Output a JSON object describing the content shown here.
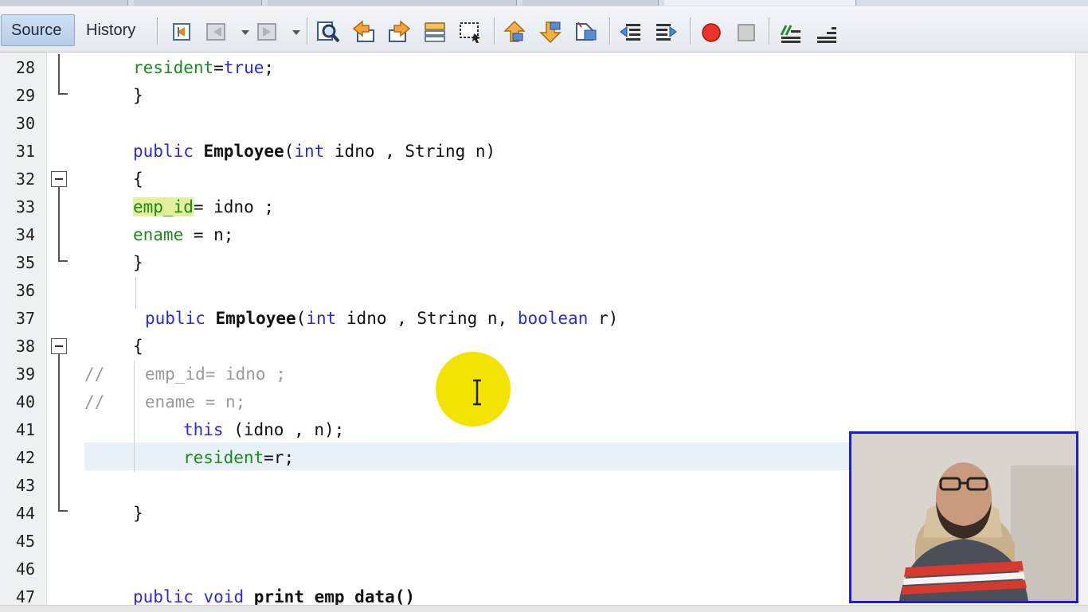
{
  "toolbar": {
    "source_label": "Source",
    "history_label": "History",
    "icons": [
      "last-edit-icon",
      "back-icon",
      "forward-icon",
      "find-icon",
      "find-previous-icon",
      "find-next-icon",
      "toggle-highlight-icon",
      "rectangle-selection-icon",
      "previous-bookmark-icon",
      "next-bookmark-icon",
      "toggle-bookmark-icon",
      "shift-left-icon",
      "shift-right-icon",
      "record-macro-icon",
      "stop-macro-icon",
      "comment-icon",
      "uncomment-icon"
    ]
  },
  "lines": [
    {
      "num": "28"
    },
    {
      "num": "29"
    },
    {
      "num": "30"
    },
    {
      "num": "31"
    },
    {
      "num": "32"
    },
    {
      "num": "33"
    },
    {
      "num": "34"
    },
    {
      "num": "35"
    },
    {
      "num": "36"
    },
    {
      "num": "37"
    },
    {
      "num": "38"
    },
    {
      "num": "39"
    },
    {
      "num": "40"
    },
    {
      "num": "41"
    },
    {
      "num": "42"
    },
    {
      "num": "43"
    },
    {
      "num": "44"
    },
    {
      "num": "45"
    },
    {
      "num": "46"
    },
    {
      "num": "47"
    }
  ],
  "code": {
    "l28_field": "resident",
    "l28_rest": "=",
    "l28_kw": "true",
    "l28_end": ";",
    "l29": "}",
    "l31_kw1": "public",
    "l31_name": "Employee",
    "l31_p1": "(",
    "l31_kw2": "int",
    "l31_p2": " idno , String n)",
    "l32": "{",
    "l33_field": "emp_id",
    "l33_rest": "= idno ;",
    "l34_field": "ename",
    "l34_rest": " = n;",
    "l35": "}",
    "l37_kw1": "public",
    "l37_name": "Employee",
    "l37_p1": "(",
    "l37_kw2": "int",
    "l37_p2": " idno , String n, ",
    "l37_kw3": "boolean",
    "l37_p3": " r)",
    "l38": "{",
    "l39_comment": "//    emp_id= idno ;",
    "l40_comment": "//    ename = n;",
    "l41_kw": "this",
    "l41_rest": " (idno , n);",
    "l42_field": "resident",
    "l42_rest": "=r;",
    "l44": "}",
    "l47_kw1": "public",
    "l47_kw2": "void",
    "l47_rest": "print emp data()"
  }
}
